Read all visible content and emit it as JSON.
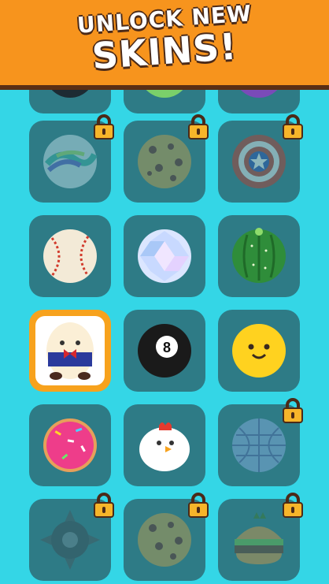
{
  "banner": {
    "line1": "UNLOCK NEW",
    "line2": "SKINS!"
  },
  "skins": [
    {
      "name": "marble",
      "locked": true
    },
    {
      "name": "cookie",
      "locked": true
    },
    {
      "name": "captain-shield",
      "locked": true
    },
    {
      "name": "baseball",
      "locked": false
    },
    {
      "name": "diamond",
      "locked": false
    },
    {
      "name": "cactus",
      "locked": false
    },
    {
      "name": "egg-character",
      "locked": false,
      "selected": true
    },
    {
      "name": "eight-ball",
      "locked": false,
      "label": "8"
    },
    {
      "name": "smiley",
      "locked": false
    },
    {
      "name": "donut",
      "locked": false
    },
    {
      "name": "chicken",
      "locked": false
    },
    {
      "name": "disco-ball",
      "locked": true
    },
    {
      "name": "spiked-mine",
      "locked": true
    },
    {
      "name": "cookie",
      "locked": true
    },
    {
      "name": "burger",
      "locked": true
    }
  ],
  "colors": {
    "background": "#34d6e6",
    "tile": "#2e7b86",
    "selected": "#f7a21d",
    "banner": "#f7941d",
    "lock": "#f7b52a"
  }
}
